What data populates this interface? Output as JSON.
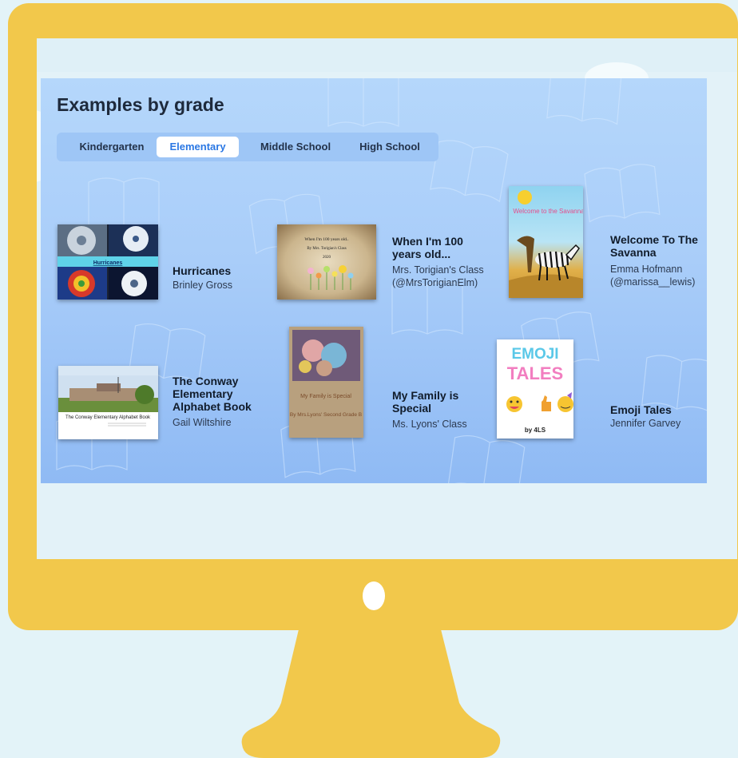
{
  "page": {
    "title": "Examples by grade"
  },
  "tabs": [
    {
      "label": "Kindergarten",
      "active": false
    },
    {
      "label": "Elementary",
      "active": true
    },
    {
      "label": "Middle School",
      "active": false
    },
    {
      "label": "High School",
      "active": false
    }
  ],
  "books": [
    {
      "title": "Hurricanes",
      "author": "Brinley Gross",
      "cover_text": "Hurricanes"
    },
    {
      "title": "When I'm 100 years old...",
      "author": "Mrs. Torigian's Class (@MrsTorigianElm)",
      "cover_text": "When I'm 100 years old..",
      "cover_subtext": "By Mrs. Torigian's Class",
      "cover_year": "2020"
    },
    {
      "title": "Welcome To The Savanna",
      "author": "Emma Hofmann (@marissa__lewis)",
      "cover_text": "Welcome to the Savanna"
    },
    {
      "title": "The Conway Elementary Alphabet Book",
      "author": "Gail Wiltshire",
      "cover_text": "The Conway Elementary Alphabet Book"
    },
    {
      "title": "My Family is Special",
      "author": "Ms. Lyons' Class",
      "cover_text": "My Family is Special",
      "cover_subtext": "By Mrs.Lyons' Second Grade B"
    },
    {
      "title": "Emoji Tales",
      "author": "Jennifer Garvey",
      "cover_text_1": "EMOJI",
      "cover_text_2": "TALES",
      "cover_subtext": "by 4LS"
    }
  ],
  "colors": {
    "monitor": "#f2c84b",
    "panel_top": "#b5d7fb",
    "panel_bottom": "#8fbaf4",
    "active_tab_text": "#2b78e4"
  }
}
